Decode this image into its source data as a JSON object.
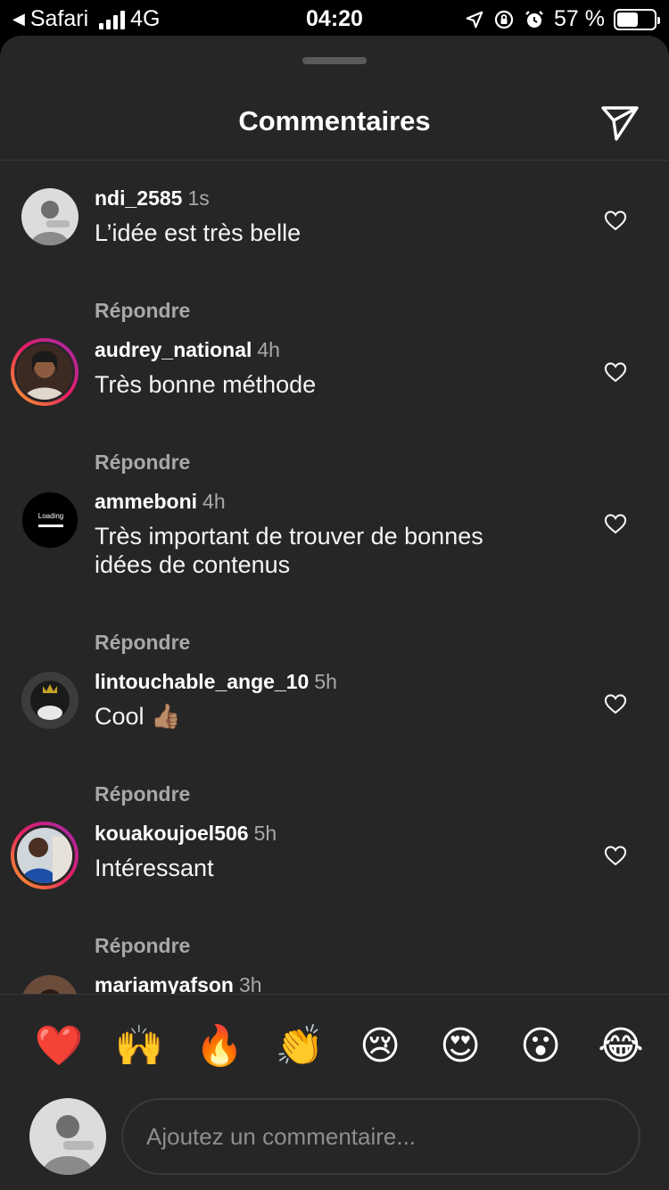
{
  "status_bar": {
    "back_app": "Safari",
    "network": "4G",
    "time": "04:20",
    "battery": "57 %",
    "battery_level": 0.57
  },
  "header": {
    "title": "Commentaires",
    "send_icon": "paper-plane-icon"
  },
  "comments": [
    {
      "username": "ndi_2585",
      "time": "1s",
      "text": "L’idée est très belle",
      "reply": "Répondre",
      "ring": false
    },
    {
      "username": "audrey_national",
      "time": "4h",
      "text": "Très bonne méthode",
      "reply": "Répondre",
      "ring": true
    },
    {
      "username": "ammeboni",
      "time": "4h",
      "text": "Très important de trouver de bonnes idées de contenus",
      "reply": "Répondre",
      "ring": false,
      "avatar_text": "Loading"
    },
    {
      "username": "lintouchable_ange_10",
      "time": "5h",
      "text": "Cool 👍🏽",
      "reply": "Répondre",
      "ring": false
    },
    {
      "username": "kouakoujoel506",
      "time": "5h",
      "text": "Intéressant",
      "reply": "Répondre",
      "ring": true
    },
    {
      "username": "mariamyafson",
      "time": "3h"
    }
  ],
  "emoji_bar": [
    "❤️",
    "🙌",
    "🔥",
    "👏",
    "😢",
    "😍",
    "😮",
    "😂"
  ],
  "composer": {
    "placeholder": "Ajoutez un commentaire..."
  }
}
